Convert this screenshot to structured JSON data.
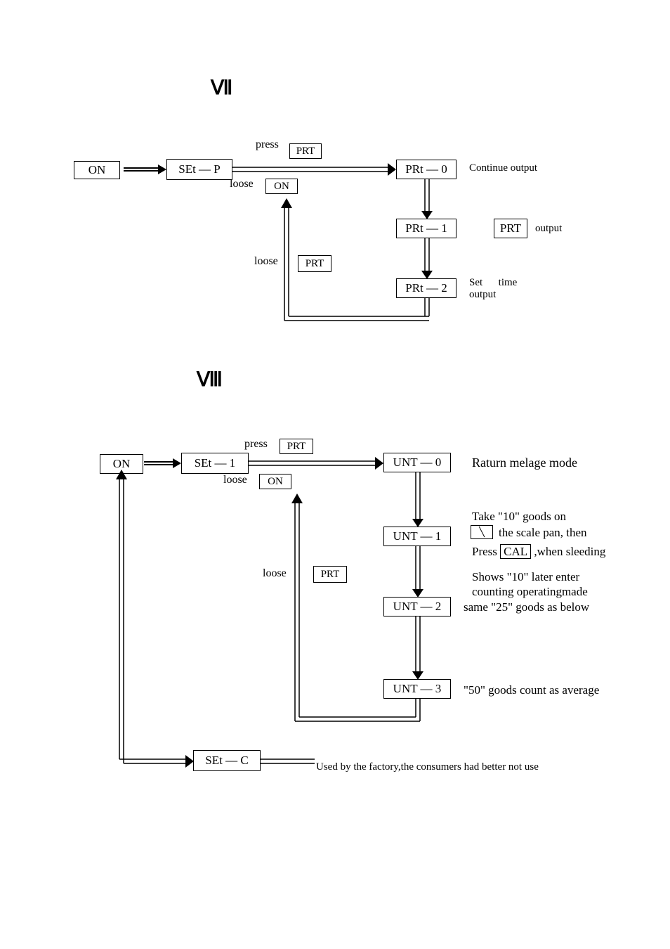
{
  "headings": {
    "seven": "Ⅶ",
    "eight": "Ⅷ"
  },
  "d7": {
    "on": "ON",
    "set_p": "SEt  —  P",
    "press": "press",
    "loose1": "loose",
    "loose2": "loose",
    "prt_btn1": "PRT",
    "on_btn": "ON",
    "prt_btn2": "PRT",
    "prt0": "PRt — 0",
    "prt1": "PRt — 1",
    "prt2": "PRt — 2",
    "cont_out": "Continue output",
    "prt_out_box": "PRT",
    "prt_out_lbl": "output",
    "set_time": "Set      time\noutput"
  },
  "d8": {
    "on": "ON",
    "set_1": "SEt  —  1",
    "press": "press",
    "loose1": "loose",
    "loose2": "loose",
    "prt_btn1": "PRT",
    "on_btn": "ON",
    "prt_btn2": "PRT",
    "unt0": "UNT — 0",
    "unt1": "UNT — 1",
    "unt2": "UNT — 2",
    "unt3": "UNT — 3",
    "desc0": "Raturn melage mode",
    "desc1a": "Take \"10\" goods on",
    "desc1b": "the scale pan, then",
    "desc1c": "Press CAL ,when sleeding",
    "desc1d": "Shows \"10\" later enter",
    "desc1e": "counting operatingmade",
    "cal": "CAL",
    "desc2": "same \"25\" goods as below",
    "desc3": "\"50\" goods count as average",
    "set_c": "SEt  —  C",
    "set_c_desc": "Used by the factory,the consumers had better not use"
  }
}
